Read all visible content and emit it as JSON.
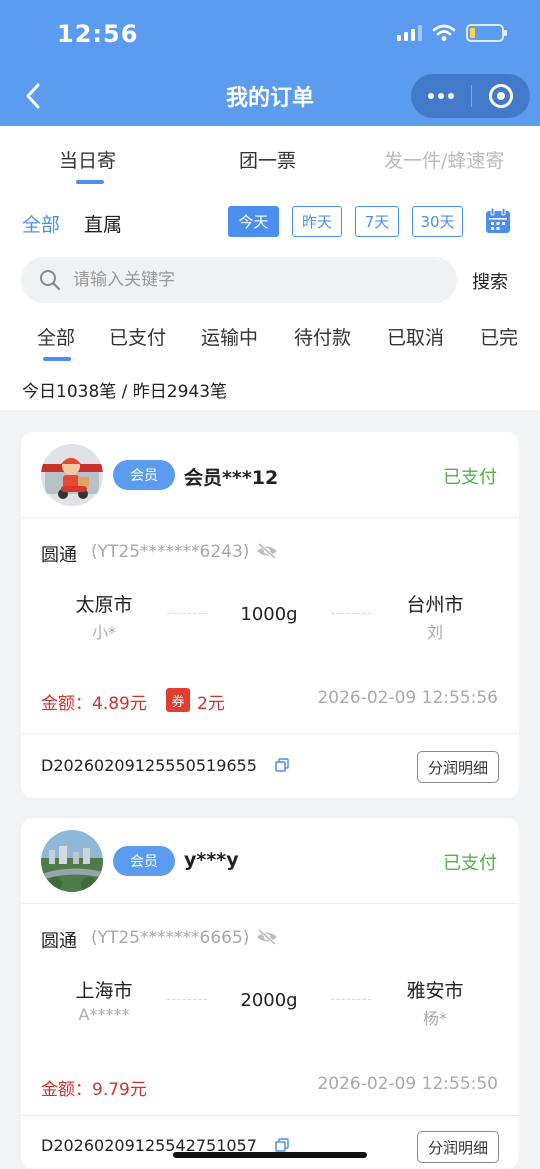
{
  "status_bar": {
    "time": "12:56"
  },
  "header": {
    "title": "我的订单"
  },
  "type_tabs": [
    {
      "label": "当日寄",
      "active": true
    },
    {
      "label": "团一票",
      "active": false
    },
    {
      "label": "发一件/蜂速寄",
      "active": false,
      "disabled": true
    }
  ],
  "scope_tabs": [
    {
      "label": "全部",
      "active": true
    },
    {
      "label": "直属",
      "active": false
    }
  ],
  "date_filters": [
    {
      "label": "今天",
      "active": true
    },
    {
      "label": "昨天",
      "active": false
    },
    {
      "label": "7天",
      "active": false
    },
    {
      "label": "30天",
      "active": false
    }
  ],
  "search": {
    "placeholder": "请输入关键字",
    "value": "",
    "button_label": "搜索"
  },
  "status_tabs": [
    {
      "label": "全部",
      "active": true
    },
    {
      "label": "已支付"
    },
    {
      "label": "运输中"
    },
    {
      "label": "待付款"
    },
    {
      "label": "已取消"
    },
    {
      "label": "已完"
    }
  ],
  "summary": "今日1038笔 / 昨日2943笔",
  "orders": [
    {
      "member_badge": "会员",
      "user_name": "会员***12",
      "status": "已支付",
      "carrier": "圆通",
      "waybill": "(YT25*******6243)",
      "from_city": "太原市",
      "from_person": "小*",
      "weight": "1000g",
      "to_city": "台州市",
      "to_person": "刘",
      "amount_label": "金额：",
      "amount": "4.89元",
      "coupon_icon": "券",
      "coupon_amount": "2元",
      "time": "2026-02-09 12:55:56",
      "order_no": "D20260209125550519655",
      "profit_button": "分润明细"
    },
    {
      "member_badge": "会员",
      "user_name": "y***y",
      "status": "已支付",
      "carrier": "圆通",
      "waybill": "(YT25*******6665)",
      "from_city": "上海市",
      "from_person": "A*****",
      "weight": "2000g",
      "to_city": "雅安市",
      "to_person": "杨*",
      "amount_label": "金额：",
      "amount": "9.79元",
      "time": "2026-02-09 12:55:50",
      "order_no": "D20260209125542751057",
      "profit_button": "分润明细"
    }
  ],
  "colors": {
    "brand": "#5b9cf0",
    "accent": "#4a8ff0",
    "paid": "#52b248",
    "amount": "#d4332b"
  }
}
